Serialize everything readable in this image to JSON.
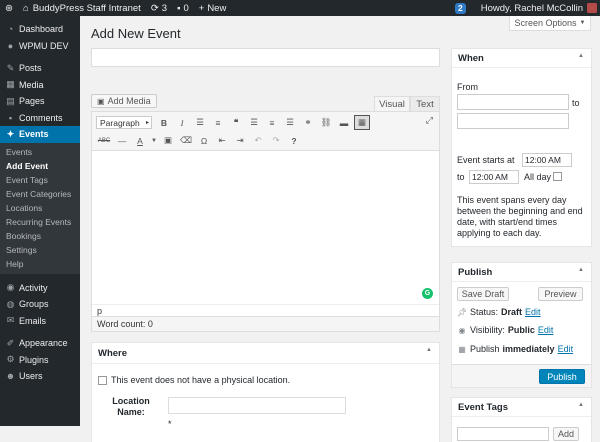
{
  "adminbar": {
    "site_name": "BuddyPress Staff Intranet",
    "updates_count": "3",
    "comments_count": "0",
    "new_label": "New",
    "notif_count": "2",
    "greeting": "Howdy, Rachel McCollin"
  },
  "sidebar": {
    "items": [
      {
        "label": "Dashboard",
        "icon": "dashboard-icon"
      },
      {
        "label": "WPMU DEV",
        "icon": "wpmudev-icon"
      },
      {
        "label": "Posts",
        "icon": "pin-icon"
      },
      {
        "label": "Media",
        "icon": "media-icon"
      },
      {
        "label": "Pages",
        "icon": "page-icon"
      },
      {
        "label": "Comments",
        "icon": "comment-icon"
      },
      {
        "label": "Events",
        "icon": "events-icon"
      }
    ],
    "submenu": [
      "Events",
      "Add Event",
      "Event Tags",
      "Event Categories",
      "Locations",
      "Recurring Events",
      "Bookings",
      "Settings",
      "Help"
    ],
    "items2": [
      {
        "label": "Activity",
        "icon": "activity-icon"
      },
      {
        "label": "Groups",
        "icon": "groups-icon"
      },
      {
        "label": "Emails",
        "icon": "email-icon"
      },
      {
        "label": "Appearance",
        "icon": "brush-icon"
      },
      {
        "label": "Plugins",
        "icon": "plugin-icon"
      },
      {
        "label": "Users",
        "icon": "users-icon"
      }
    ]
  },
  "header": {
    "screen_options": "Screen Options",
    "title": "Add New Event"
  },
  "editor": {
    "add_media": "Add Media",
    "tab_visual": "Visual",
    "tab_text": "Text",
    "format": "Paragraph",
    "path": "p",
    "word_count": "Word count: 0"
  },
  "where": {
    "title": "Where",
    "no_location": "This event does not have a physical location.",
    "location_name_label": "Location Name:",
    "required": "*"
  },
  "when": {
    "title": "When",
    "from": "From",
    "to": "to",
    "starts_at": "Event starts at",
    "start_time": "12:00 AM",
    "to2": "to",
    "end_time": "12:00 AM",
    "all_day": "All day",
    "note": "This event spans every day between the beginning and end date, with start/end times applying to each day."
  },
  "publish": {
    "title": "Publish",
    "save_draft": "Save Draft",
    "preview": "Preview",
    "status_label": "Status:",
    "status_value": "Draft",
    "visibility_label": "Visibility:",
    "visibility_value": "Public",
    "publish_label": "Publish",
    "publish_value": "immediately",
    "edit": "Edit",
    "publish_button": "Publish"
  },
  "tags": {
    "title": "Event Tags",
    "add": "Add"
  },
  "colors": {
    "admin_dark": "#23282d",
    "accent": "#0073aa",
    "button_primary": "#0085ba"
  }
}
